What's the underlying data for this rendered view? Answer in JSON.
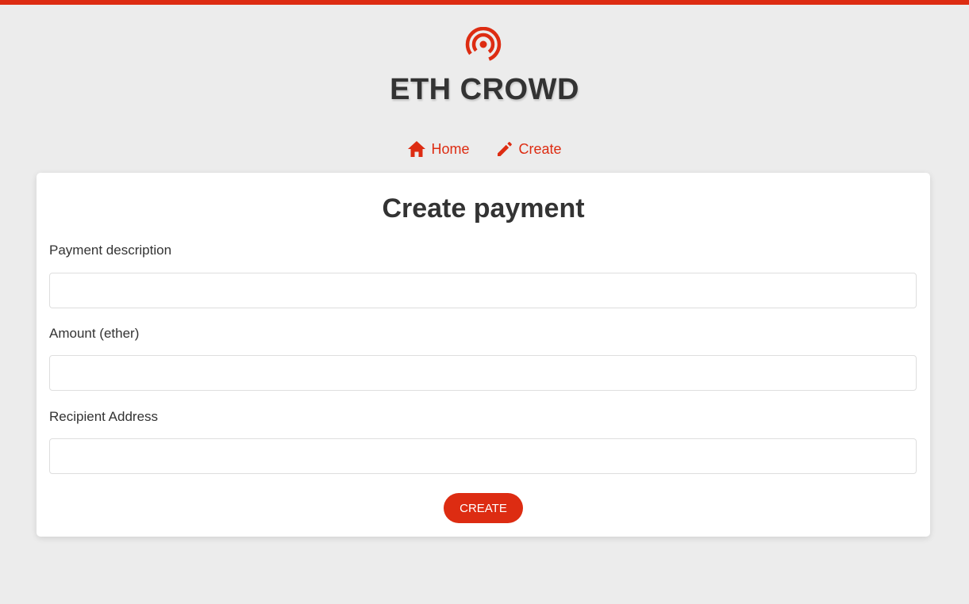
{
  "colors": {
    "accent": "#dd2c12",
    "background": "#ececec",
    "card": "#ffffff",
    "text": "#333333"
  },
  "header": {
    "logo_icon": "broadcast-signal-icon",
    "title": "ETH CROWD"
  },
  "nav": {
    "items": [
      {
        "label": "Home",
        "icon": "home-icon"
      },
      {
        "label": "Create",
        "icon": "pencil-icon"
      }
    ]
  },
  "form": {
    "title": "Create payment",
    "fields": [
      {
        "label": "Payment description",
        "value": "",
        "placeholder": ""
      },
      {
        "label": "Amount (ether)",
        "value": "",
        "placeholder": ""
      },
      {
        "label": "Recipient Address",
        "value": "",
        "placeholder": ""
      }
    ],
    "submit_label": "CREATE"
  }
}
